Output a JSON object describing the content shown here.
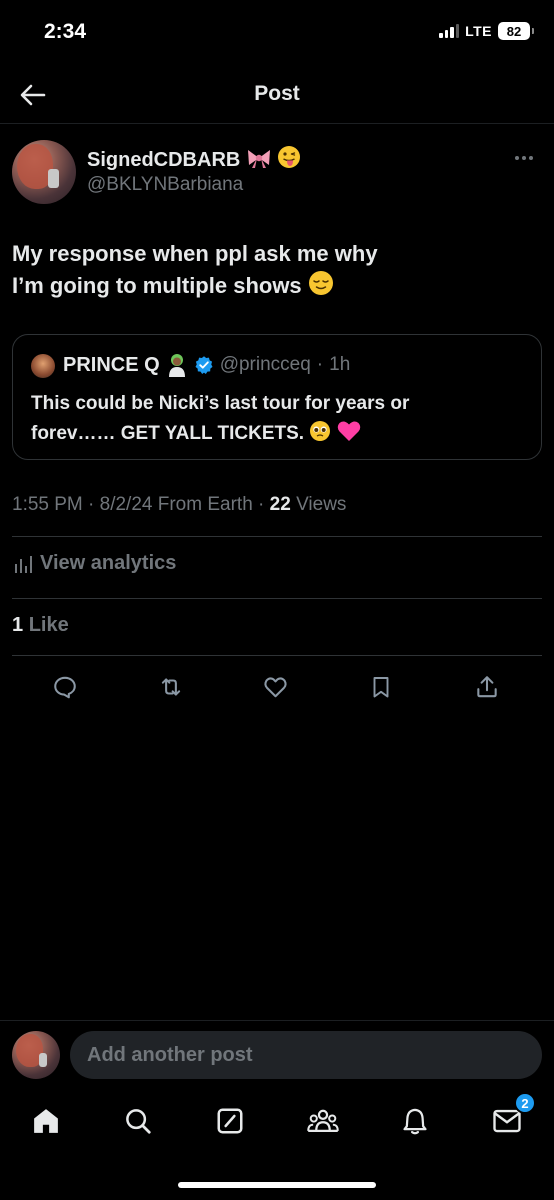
{
  "status_bar": {
    "time": "2:34",
    "network": "LTE",
    "battery": "82"
  },
  "header": {
    "title": "Post"
  },
  "post": {
    "author_name": "SignedCDBARB",
    "author_handle": "@BKLYNBarbiana",
    "text_line1": "My response when ppl ask me why",
    "text_line2": "I’m going to multiple shows",
    "quote": {
      "name": "PRINCE Q",
      "handle": "@princceq",
      "time": "1h",
      "text_line1": "This could be Nicki’s last tour for years or",
      "text_line2": "forev…… GET YALL TICKETS."
    },
    "timestamp": "1:55 PM · 8/2/24 From Earth ·",
    "views_count": "22",
    "views_label": "Views",
    "analytics_label": "View analytics",
    "likes_count": "1",
    "likes_label": "Like"
  },
  "compose": {
    "placeholder": "Add another post"
  },
  "tabs": {
    "messages_badge": "2"
  },
  "colors": {
    "background": "#000000",
    "text": "#e7e9ea",
    "muted": "#71767b",
    "accent": "#1d9bf0",
    "divider": "#2f3336"
  },
  "icons": [
    "back-arrow-icon",
    "more-icon",
    "verified-icon",
    "analytics-icon",
    "reply-icon",
    "repost-icon",
    "like-icon",
    "bookmark-icon",
    "share-icon",
    "home-icon",
    "search-icon",
    "grok-icon",
    "communities-icon",
    "notifications-icon",
    "messages-icon"
  ]
}
